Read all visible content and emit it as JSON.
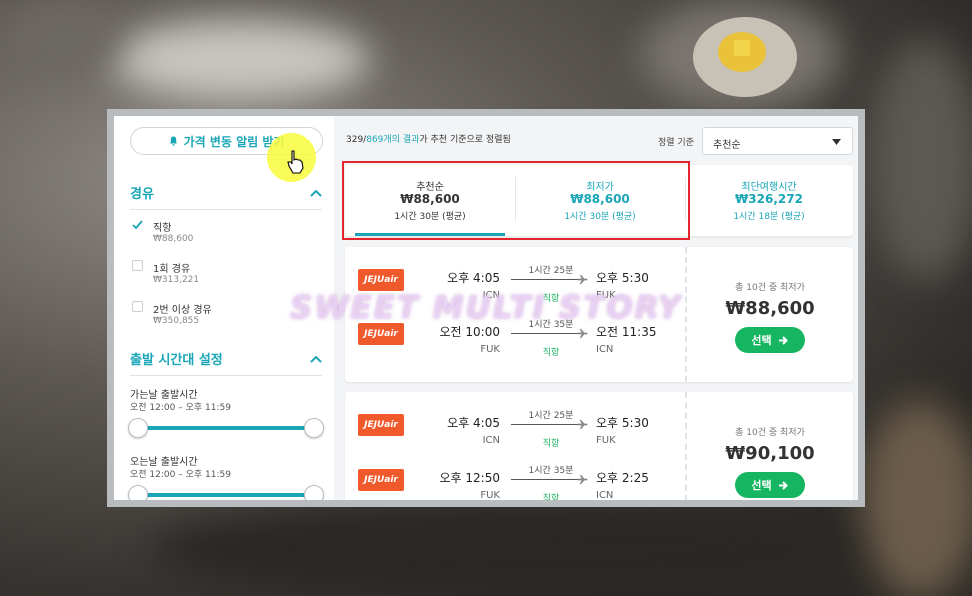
{
  "sidebar": {
    "alert_button": "가격 변동 알림 받기",
    "stops": {
      "heading": "경유",
      "options": [
        {
          "label": "직항",
          "price": "₩88,600",
          "checked": true
        },
        {
          "label": "1회 경유",
          "price": "₩313,221",
          "checked": false
        },
        {
          "label": "2번 이상 경유",
          "price": "₩350,855",
          "checked": false
        }
      ]
    },
    "departure": {
      "heading": "출발 시간대 설정",
      "outbound_label": "가는날 출발시간",
      "outbound_range": "오전 12:00 – 오후 11:59",
      "return_label": "오는날 출발시간",
      "return_range": "오전 12:00 – 오후 11:59"
    }
  },
  "main": {
    "results": {
      "shown": "329/",
      "total": "869개의 결과",
      "suffix": "가 추천 기준으로 정렬됨"
    },
    "sort_label": "정렬 기준",
    "sort_value": "추천순",
    "tabs": [
      {
        "title": "추천순",
        "price": "₩88,600",
        "duration": "1시간 30분 (평균)",
        "active": true
      },
      {
        "title": "최저가",
        "price": "₩88,600",
        "duration": "1시간 30분 (평균)",
        "active": false
      },
      {
        "title": "최단여행시간",
        "price": "₩326,272",
        "duration": "1시간 18분 (평균)",
        "active": false
      }
    ],
    "cards": [
      {
        "legs": [
          {
            "airline": "JEJUair",
            "dep_time": "오후 4:05",
            "dep_code": "ICN",
            "duration": "1시간 25분",
            "type": "직항",
            "arr_time": "오후 5:30",
            "arr_code": "FUK"
          },
          {
            "airline": "JEJUair",
            "dep_time": "오전 10:00",
            "dep_code": "FUK",
            "duration": "1시간 35분",
            "type": "직항",
            "arr_time": "오전 11:35",
            "arr_code": "ICN"
          }
        ],
        "note": "총 10건 중 최저가",
        "price": "₩88,600",
        "button": "선택"
      },
      {
        "legs": [
          {
            "airline": "JEJUair",
            "dep_time": "오후 4:05",
            "dep_code": "ICN",
            "duration": "1시간 25분",
            "type": "직항",
            "arr_time": "오후 5:30",
            "arr_code": "FUK"
          },
          {
            "airline": "JEJUair",
            "dep_time": "오후 12:50",
            "dep_code": "FUK",
            "duration": "1시간 35분",
            "type": "직항",
            "arr_time": "오후 2:25",
            "arr_code": "ICN"
          }
        ],
        "note": "총 10건 중 최저가",
        "price": "₩90,100",
        "button": "선택"
      }
    ]
  },
  "watermark": "SWEET MULTI STORY",
  "colors": {
    "accent": "#1aa6b7",
    "select_green": "#16b561",
    "highlight_red": "#e3262d",
    "airline_orange": "#f0592b"
  }
}
